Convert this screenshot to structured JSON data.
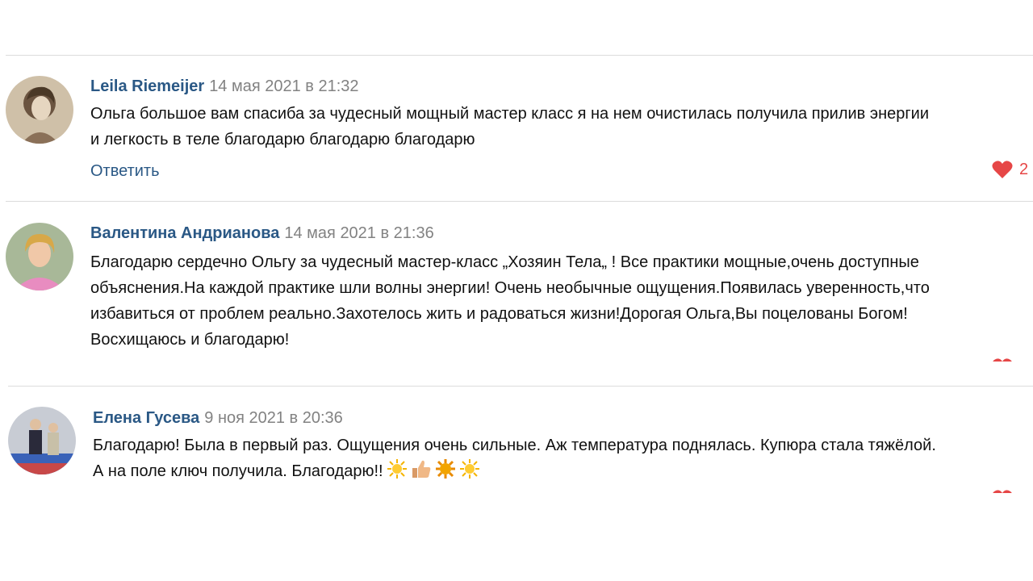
{
  "comments": [
    {
      "author": "Leila Riemeijer",
      "date": "14 мая 2021 в 21:32",
      "lines": [
        "Ольга большое вам спасиба за чудесный мощный мастер класс я на нем очистилась получила прилив энергии",
        "и легкость в теле благодарю благодарю благодарю"
      ],
      "reply_label": "Ответить",
      "likes": "2",
      "avatar_icon": "avatar-photo-woman-sepia"
    },
    {
      "author": "Валентина Андрианова",
      "date": "14 мая 2021 в 21:36",
      "lines": [
        "Благодарю сердечно Ольгу за чудесный мастер-класс „Хозяин Тела„ ! Все практики мощные,очень доступные",
        "объяснения.На каждой практике шли волны энергии! Очень необычные ощущения.Появилась уверенность,что",
        "избавиться от проблем реально.Захотелось жить и радоваться жизни!Дорогая Ольга,Вы поцелованы Богом!",
        "Восхищаюсь и благодарю!"
      ],
      "avatar_icon": "avatar-photo-woman-pink"
    },
    {
      "author": "Елена Гусева",
      "date": "9 ноя 2021 в 20:36",
      "lines": [
        "Благодарю! Была в первый раз. Ощущения очень сильные. Аж температура поднялась. Купюра стала тяжёлой.",
        "А на поле ключ получила. Благодарю!!"
      ],
      "emojis": [
        "sun-emoji",
        "thumbs-up-emoji",
        "sun-emoji",
        "sun-emoji"
      ],
      "avatar_icon": "avatar-photo-two-people"
    }
  ],
  "colors": {
    "author": "#2a5885",
    "date": "#828282",
    "like": "#e64646",
    "divider": "#dcdcdc"
  }
}
